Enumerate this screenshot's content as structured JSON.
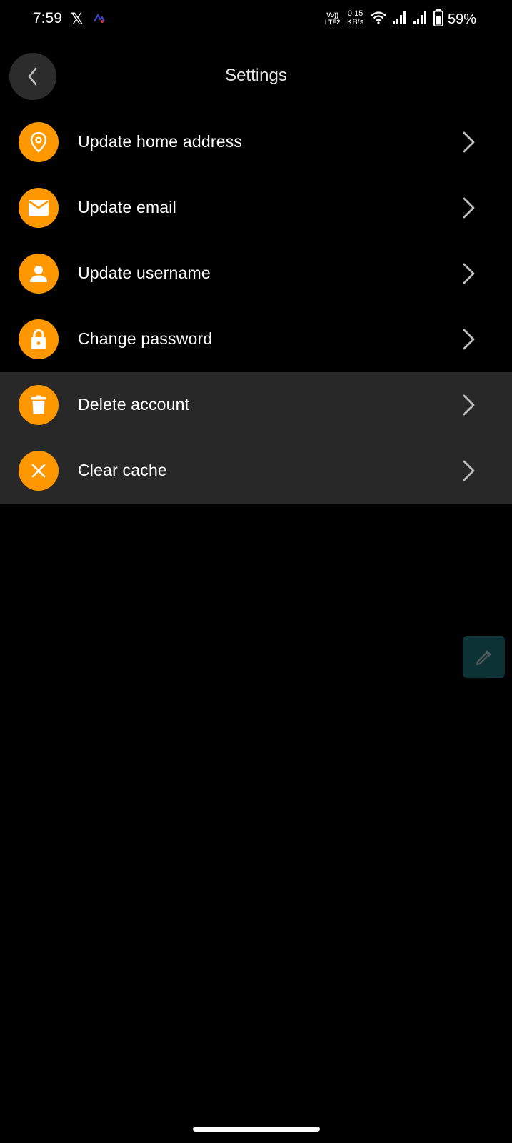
{
  "status_bar": {
    "time": "7:59",
    "x_logo": "𝕏",
    "volte_line1": "Vo))",
    "volte_line2": "LTE2",
    "net_speed_value": "0.15",
    "net_speed_unit": "KB/s",
    "battery_percent": "59%"
  },
  "header": {
    "title": "Settings",
    "back_icon": "chevron-left-icon"
  },
  "settings": {
    "items": [
      {
        "label": "Update home address",
        "icon": "location-pin-icon"
      },
      {
        "label": "Update email",
        "icon": "mail-icon"
      },
      {
        "label": "Update username",
        "icon": "person-icon"
      },
      {
        "label": "Change password",
        "icon": "lock-icon"
      },
      {
        "label": "Delete account",
        "icon": "trash-icon"
      },
      {
        "label": "Clear cache",
        "icon": "close-icon"
      }
    ]
  },
  "fab": {
    "icon": "eyedropper-icon"
  },
  "colors": {
    "accent": "#ff9800",
    "background": "#000000",
    "highlight_row": "#282828",
    "fab_background": "#0d3236"
  }
}
